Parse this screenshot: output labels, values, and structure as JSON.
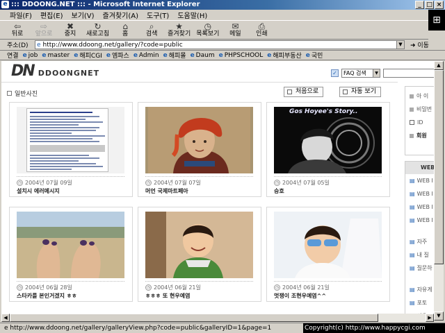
{
  "window": {
    "title": "::: DDOONG.NET ::: - Microsoft Internet Explorer",
    "controls": [
      "_",
      "□",
      "×"
    ]
  },
  "menu": [
    "파일(F)",
    "편집(E)",
    "보기(V)",
    "즐겨찾기(A)",
    "도구(T)",
    "도움말(H)"
  ],
  "toolbar": [
    {
      "label": "뒤로",
      "icon": "back-arrow",
      "glyph": "⇦",
      "enabled": true
    },
    {
      "label": "앞으로",
      "icon": "forward-arrow",
      "glyph": "⇨",
      "enabled": false
    },
    {
      "label": "중지",
      "icon": "stop",
      "glyph": "✖",
      "enabled": true
    },
    {
      "label": "새로고침",
      "icon": "refresh",
      "glyph": "↻",
      "enabled": true
    },
    {
      "label": "홈",
      "icon": "home",
      "glyph": "⌂",
      "enabled": true
    },
    {
      "label": "검색",
      "icon": "search",
      "glyph": "⌕",
      "enabled": true
    },
    {
      "label": "즐겨찾기",
      "icon": "favorites",
      "glyph": "★",
      "enabled": true
    },
    {
      "label": "목록보기",
      "icon": "history",
      "glyph": "◷",
      "enabled": true
    },
    {
      "label": "메일",
      "icon": "mail",
      "glyph": "✉",
      "enabled": true
    },
    {
      "label": "인쇄",
      "icon": "print",
      "glyph": "⎙",
      "enabled": true
    }
  ],
  "address": {
    "label": "주소(D)",
    "url": "http://www.ddoong.net/gallery/?code=public",
    "go_label": "이동"
  },
  "links": {
    "label": "연결",
    "items": [
      "job",
      "master",
      "해피CGI",
      "엠파스",
      "Admin",
      "해피몰",
      "Daum",
      "PHPSCHOOL",
      "해피부동산",
      "국민"
    ]
  },
  "page": {
    "logo_mark": "DN",
    "logo_name": "DDOONGNET",
    "search_select": "FAQ 검색",
    "section_title": "일반사진",
    "btn_first": "처음으로",
    "btn_auto": "자동 보기",
    "cards": [
      {
        "date": "2004년 07월 09일",
        "title": "설치시 에러메시지"
      },
      {
        "date": "2004년 07월 07일",
        "title": "머언 국제마트페아"
      },
      {
        "date": "2004년 07월 05일",
        "title": "승호",
        "overlay_text": "Gos Hoyee's Story.."
      },
      {
        "date": "2004년 06월 28일",
        "title": "스타카를 본인거겠지 ㅎㅎ"
      },
      {
        "date": "2004년 06월 21일",
        "title": "ㅎㅎㅎ 또 현우예염"
      },
      {
        "date": "2004년 06월 21일",
        "title": "멋쟁이 조현우예염^^"
      }
    ],
    "sidebar": {
      "login_lines": [
        "아 이",
        "비밀번",
        "ID",
        "회원"
      ],
      "web_head": "WEB",
      "web_items": [
        "WEB I",
        "WEB I",
        "WEB I",
        "WEB I"
      ],
      "qa_items": [
        "자주",
        "내 질",
        "질문하"
      ],
      "more_items": [
        "자유게",
        "포토",
        "사용",
        "서"
      ]
    }
  },
  "status": {
    "url": "http://www.ddoong.net/gallery/galleryView.php?code=public&galleryID=1&page=1",
    "copyright": "Copyright(c) http://www.happycgi.com"
  }
}
